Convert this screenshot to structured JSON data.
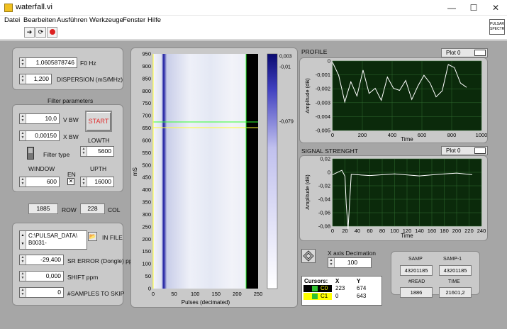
{
  "window": {
    "title": "waterfall.vi",
    "controls": [
      "—",
      "☐",
      "✕"
    ]
  },
  "menu": [
    "Datei",
    "Bearbeiten",
    "Ausführen",
    "Werkzeuge",
    "Fenster",
    "Hilfe"
  ],
  "badge": {
    "line1": "PULSAR",
    "line2": "SPECTR"
  },
  "top_group": {
    "f0": {
      "value": "1,0605878746",
      "label": "F0 Hz"
    },
    "dispersion": {
      "value": "1,200",
      "label": "DISPERSION (mS/MHz)"
    }
  },
  "filter": {
    "title": "Filter parameters",
    "vbw": {
      "value": "10,0",
      "label": "V BW"
    },
    "xbw": {
      "value": "0,00150",
      "label": "X BW"
    },
    "start_label": "START",
    "lowth": {
      "label": "LOWTH",
      "value": "5600"
    },
    "filter_type_label": "Filter type",
    "window": {
      "label": "WINDOW",
      "value": "600"
    },
    "en_label": "EN",
    "en_checked": true,
    "upth": {
      "label": "UPTH",
      "value": "16000"
    }
  },
  "rowcol": {
    "row_value": "1885",
    "row_label": "ROW",
    "col_value": "228",
    "col_label": "COL"
  },
  "file": {
    "path_line1": "C:\\PULSAR_DATA\\",
    "path_line2": "B0031-",
    "label": "IN FILE",
    "sr_error": {
      "value": "-29,400",
      "label": "SR ERROR (Dongle) ppm"
    },
    "shift": {
      "value": "0,000",
      "label": "SHIFT ppm"
    },
    "samples_skip": {
      "value": "0",
      "label": "#SAMPLES TO SKIP"
    }
  },
  "waterfall": {
    "y_ticks": [
      "950",
      "900",
      "850",
      "800",
      "750",
      "700",
      "650",
      "600",
      "550",
      "500",
      "450",
      "400",
      "350",
      "300",
      "250",
      "200",
      "150",
      "100",
      "50",
      "0"
    ],
    "x_ticks": [
      "0",
      "50",
      "100",
      "150",
      "200",
      "250"
    ],
    "ylabel": "mS",
    "xlabel": "Pulses (decimated)",
    "colorbar_ticks": [
      "0,003",
      "-0,01",
      "-0,079"
    ],
    "colors": {
      "dark": "#0a0a6e",
      "light": "#ffffff",
      "cursor_green": "#30ff30",
      "cursor_yellow": "#ffff30"
    }
  },
  "profile": {
    "title": "PROFILE",
    "legend": "Plot 0",
    "ylabel": "Amplitude (dB)",
    "xlabel": "Time",
    "y_ticks": [
      "0",
      "-0,001",
      "-0,002",
      "-0,003",
      "-0,004",
      "-0,005"
    ],
    "x_ticks": [
      "0",
      "200",
      "400",
      "600",
      "800",
      "1000"
    ]
  },
  "signal": {
    "title": "SIGNAL STRENGHT",
    "legend": "Plot 0",
    "ylabel": "Amplitude (dB)",
    "xlabel": "Time",
    "y_ticks": [
      "0,02",
      "0",
      "-0,02",
      "-0,04",
      "-0,06",
      "-0,08"
    ],
    "x_ticks": [
      "0",
      "20",
      "40",
      "60",
      "80",
      "100",
      "120",
      "140",
      "160",
      "180",
      "200",
      "220",
      "240"
    ]
  },
  "cursors": {
    "header": [
      "Cursors:",
      "X",
      "Y"
    ],
    "rows": [
      {
        "name": "C0",
        "x": "223",
        "y": "674"
      },
      {
        "name": "C1",
        "x": "0",
        "y": "643"
      }
    ]
  },
  "x_decimation": {
    "label": "X axis Decimation",
    "value": "100"
  },
  "stats": {
    "samp_label": "SAMP",
    "samp_value": "43201185",
    "samp1_label": "SAMP-1",
    "samp1_value": "43201185",
    "read_label": "#READ",
    "read_value": "1886",
    "time_label": "TIME",
    "time_value": "21601,2"
  }
}
